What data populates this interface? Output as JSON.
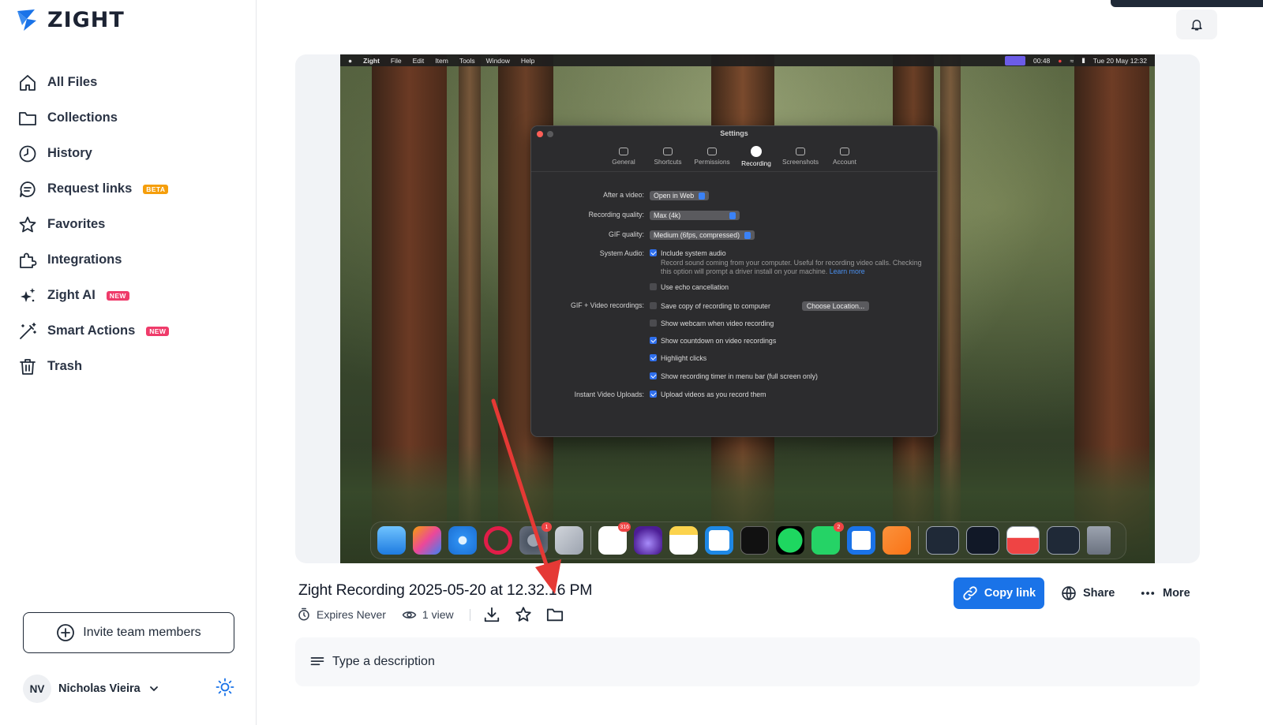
{
  "brand": {
    "name": "ZIGHT"
  },
  "sidebar": {
    "items": [
      {
        "label": "All Files",
        "icon": "home-icon"
      },
      {
        "label": "Collections",
        "icon": "folder-icon"
      },
      {
        "label": "History",
        "icon": "clock-icon"
      },
      {
        "label": "Request links",
        "icon": "chat-bubble-icon",
        "badge": "BETA"
      },
      {
        "label": "Favorites",
        "icon": "star-icon"
      },
      {
        "label": "Integrations",
        "icon": "puzzle-icon"
      },
      {
        "label": "Zight AI",
        "icon": "sparkles-icon",
        "badge": "NEW"
      },
      {
        "label": "Smart Actions",
        "icon": "magic-wand-icon",
        "badge": "NEW"
      },
      {
        "label": "Trash",
        "icon": "trash-icon"
      }
    ],
    "invite_label": "Invite team members",
    "user": {
      "initials": "NV",
      "name": "Nicholas Vieira"
    }
  },
  "recording": {
    "mac_menubar": {
      "app": "Zight",
      "menus": [
        "File",
        "Edit",
        "Item",
        "Tools",
        "Window",
        "Help"
      ],
      "timer": "00:48",
      "clock": "Tue 20 May  12:32"
    },
    "settings_window": {
      "title": "Settings",
      "tabs": [
        "General",
        "Shortcuts",
        "Permissions",
        "Recording",
        "Screenshots",
        "Account"
      ],
      "active_tab": "Recording",
      "after_video_label": "After a video:",
      "after_video_value": "Open in Web",
      "quality_label": "Recording quality:",
      "quality_value": "Max (4k)",
      "gif_label": "GIF quality:",
      "gif_value": "Medium (6fps, compressed)",
      "audio_label": "System Audio:",
      "audio_option": "Include system audio",
      "audio_help": "Record sound coming from your computer. Useful for recording video calls. Checking this option will prompt a driver install on your machine.",
      "learn_more": "Learn more",
      "echo": "Use echo cancellation",
      "gif_video_label": "GIF + Video recordings:",
      "save_copy": "Save copy of recording to computer",
      "choose_location": "Choose Location...",
      "webcam": "Show webcam when video recording",
      "countdown": "Show countdown on video recordings",
      "highlight": "Highlight clicks",
      "timer_menubar": "Show recording timer in menu bar (full screen only)",
      "instant_label": "Instant Video Uploads:",
      "upload": "Upload videos as you record them"
    },
    "dock_badges": {
      "system_settings": "1",
      "slack": "316",
      "whatsapp": "2"
    }
  },
  "file": {
    "title": "Zight Recording 2025-05-20 at 12.32.16 PM",
    "expires": "Expires Never",
    "views": "1 view"
  },
  "actions": {
    "copy_link": "Copy link",
    "share": "Share",
    "more": "More"
  },
  "description": {
    "placeholder": "Type a description"
  },
  "colors": {
    "primary": "#1a73e8",
    "new_badge": "#ef3b6a",
    "beta_badge": "#f59e0b",
    "arrow": "#e53935"
  }
}
